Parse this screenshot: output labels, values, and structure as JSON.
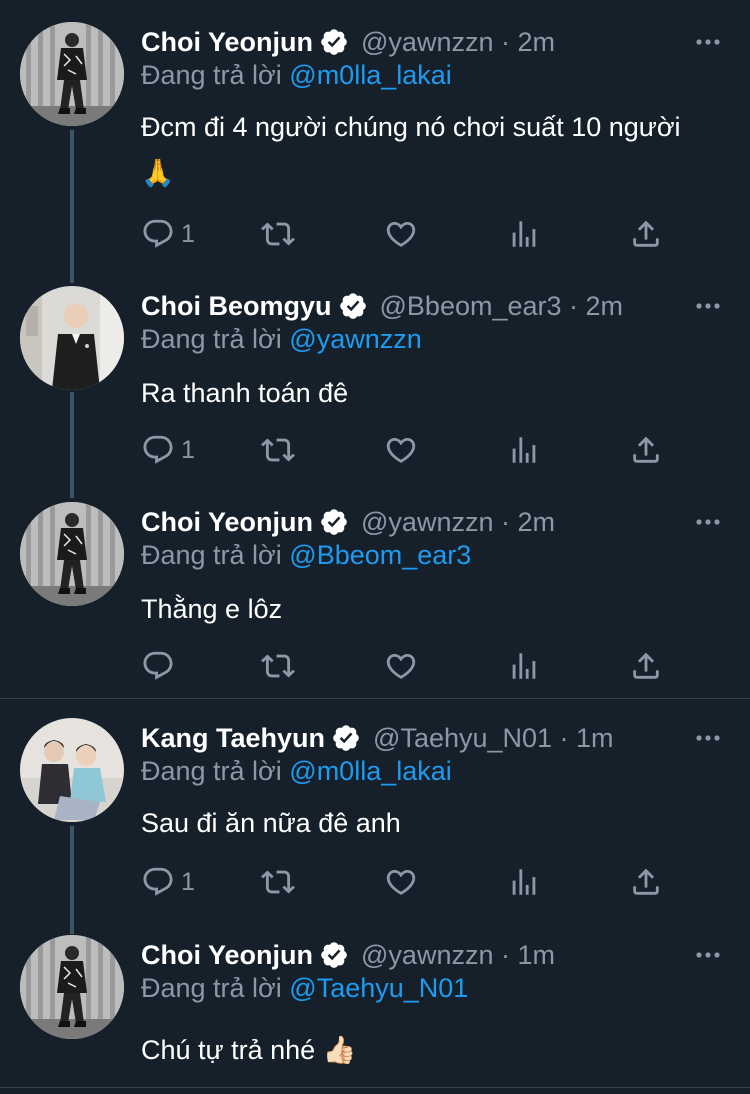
{
  "reply_prefix": "Đang trả lời",
  "tweets": [
    {
      "name": "Choi Yeonjun",
      "handle": "@yawnzzn · 2m",
      "reply_to": "@m0lla_lakai",
      "text": "Đcm đi 4 người chúng nó chơi suất 10 người 🙏",
      "reply_count": "1"
    },
    {
      "name": "Choi Beomgyu",
      "handle": "@Bbeom_ear3 · 2m",
      "reply_to": "@yawnzzn",
      "text": "Ra thanh toán đê",
      "reply_count": "1"
    },
    {
      "name": "Choi Yeonjun",
      "handle": "@yawnzzn · 2m",
      "reply_to": "@Bbeom_ear3",
      "text": "Thằng e lôz",
      "reply_count": ""
    },
    {
      "name": "Kang Taehyun",
      "handle": "@Taehyu_N01 · 1m",
      "reply_to": "@m0lla_lakai",
      "text": "Sau đi ăn nữa đê anh",
      "reply_count": "1"
    },
    {
      "name": "Choi Yeonjun",
      "handle": "@yawnzzn · 1m",
      "reply_to": "@Taehyu_N01",
      "text": "Chú tự trả nhé 👍🏻",
      "reply_count": ""
    }
  ],
  "icons": [
    "reply-icon",
    "retweet-icon",
    "like-icon",
    "analytics-icon",
    "share-icon",
    "more-icon",
    "verified-badge-icon"
  ],
  "colors": {
    "background": "#15202b",
    "text": "#ffffff",
    "secondary": "#8b98a5",
    "link": "#1d9bf0",
    "divider": "#38444d"
  }
}
